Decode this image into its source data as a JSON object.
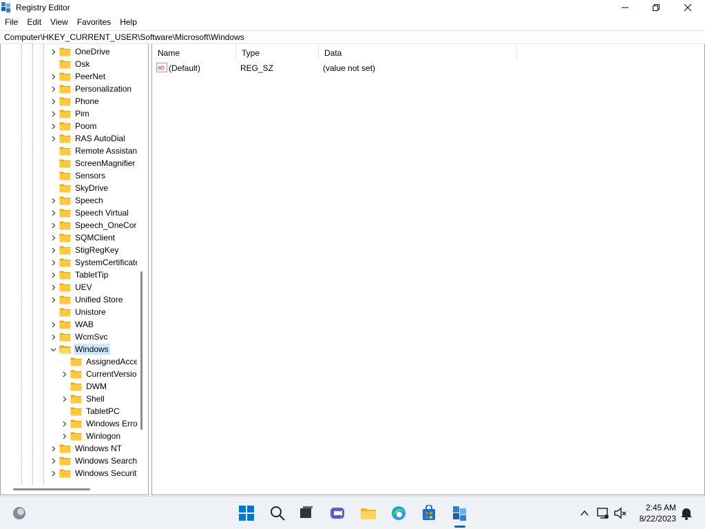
{
  "window": {
    "title": "Registry Editor"
  },
  "menu": [
    "File",
    "Edit",
    "View",
    "Favorites",
    "Help"
  ],
  "address": "Computer\\HKEY_CURRENT_USER\\Software\\Microsoft\\Windows",
  "tree": {
    "top_level": [
      {
        "label": "OneDrive",
        "expandable": true
      },
      {
        "label": "Osk",
        "expandable": false
      },
      {
        "label": "PeerNet",
        "expandable": true
      },
      {
        "label": "Personalization",
        "expandable": true
      },
      {
        "label": "Phone",
        "expandable": true
      },
      {
        "label": "Pim",
        "expandable": true
      },
      {
        "label": "Poom",
        "expandable": true
      },
      {
        "label": "RAS AutoDial",
        "expandable": true
      },
      {
        "label": "Remote Assistance",
        "expandable": false
      },
      {
        "label": "ScreenMagnifier",
        "expandable": false
      },
      {
        "label": "Sensors",
        "expandable": false
      },
      {
        "label": "SkyDrive",
        "expandable": false
      },
      {
        "label": "Speech",
        "expandable": true
      },
      {
        "label": "Speech Virtual",
        "expandable": true
      },
      {
        "label": "Speech_OneCore",
        "expandable": true
      },
      {
        "label": "SQMClient",
        "expandable": true
      },
      {
        "label": "StigRegKey",
        "expandable": true
      },
      {
        "label": "SystemCertificates",
        "expandable": true
      },
      {
        "label": "TabletTip",
        "expandable": true
      },
      {
        "label": "UEV",
        "expandable": true
      },
      {
        "label": "Unified Store",
        "expandable": true
      },
      {
        "label": "Unistore",
        "expandable": false
      },
      {
        "label": "WAB",
        "expandable": true
      },
      {
        "label": "WcmSvc",
        "expandable": true
      },
      {
        "label": "Windows",
        "expandable": true,
        "expanded": true,
        "selected": true
      }
    ],
    "children": [
      {
        "label": "AssignedAccess",
        "expandable": false
      },
      {
        "label": "CurrentVersion",
        "expandable": true
      },
      {
        "label": "DWM",
        "expandable": false
      },
      {
        "label": "Shell",
        "expandable": true
      },
      {
        "label": "TabletPC",
        "expandable": false
      },
      {
        "label": "Windows Error Reporting",
        "expandable": true
      },
      {
        "label": "Winlogon",
        "expandable": true
      }
    ],
    "after": [
      {
        "label": "Windows NT",
        "expandable": true
      },
      {
        "label": "Windows Search",
        "expandable": true
      },
      {
        "label": "Windows Security",
        "expandable": true
      }
    ]
  },
  "list": {
    "columns": [
      "Name",
      "Type",
      "Data"
    ],
    "rows": [
      {
        "name": "(Default)",
        "type": "REG_SZ",
        "data": "(value not set)"
      }
    ]
  },
  "tray": {
    "time": "2:45 AM",
    "date": "8/22/2023"
  },
  "colors": {
    "selection": "#cce8ff",
    "folder": "#ffc83d",
    "accent": "#0067c0"
  }
}
